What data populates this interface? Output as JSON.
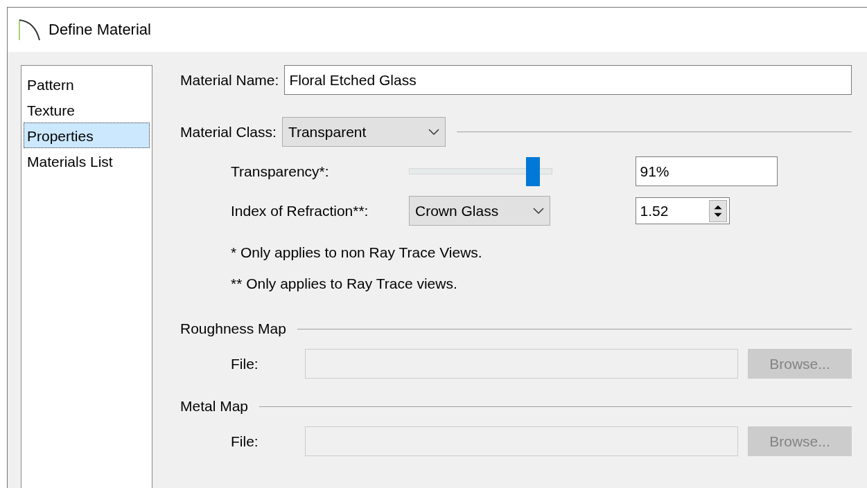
{
  "window": {
    "title": "Define Material"
  },
  "sidebar": {
    "items": [
      {
        "label": "Pattern",
        "selected": false
      },
      {
        "label": "Texture",
        "selected": false
      },
      {
        "label": "Properties",
        "selected": true
      },
      {
        "label": "Materials List",
        "selected": false
      }
    ]
  },
  "material_name": {
    "label": "Material Name:",
    "value": "Floral Etched Glass"
  },
  "material_class": {
    "label": "Material Class:",
    "value": "Transparent"
  },
  "transparency": {
    "label": "Transparency*:",
    "level": 0.91,
    "value": "91%"
  },
  "refraction": {
    "label": "Index of Refraction**:",
    "preset": "Crown Glass",
    "value": "1.52"
  },
  "notes": [
    "* Only applies to non Ray Trace Views.",
    "** Only applies to Ray Trace views."
  ],
  "maps": [
    {
      "title": "Roughness Map",
      "file_label": "File:",
      "browse": "Browse...",
      "disabled": true
    },
    {
      "title": "Metal Map",
      "file_label": "File:",
      "browse": "Browse...",
      "disabled": true
    }
  ]
}
